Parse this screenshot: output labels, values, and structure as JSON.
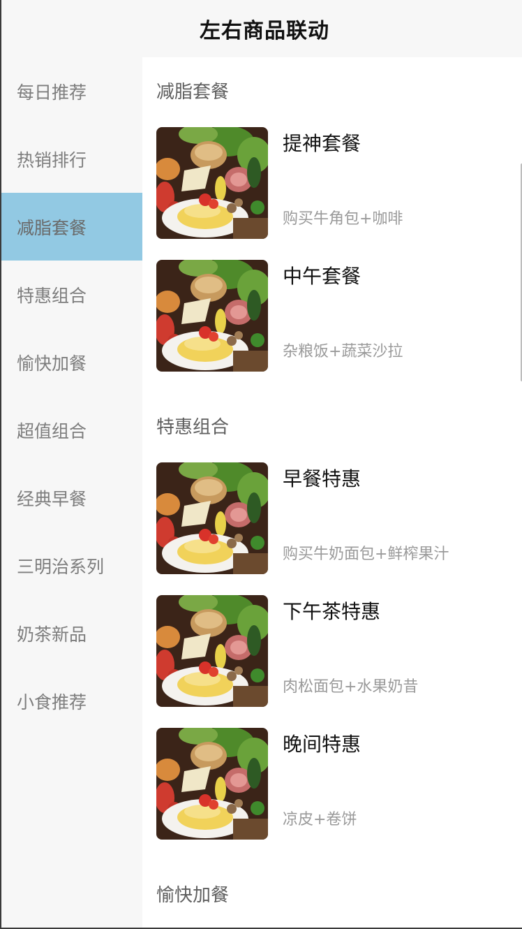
{
  "header": {
    "title": "左右商品联动"
  },
  "sidebar": {
    "active_index": 2,
    "items": [
      {
        "label": "每日推荐"
      },
      {
        "label": "热销排行"
      },
      {
        "label": "减脂套餐"
      },
      {
        "label": "特惠组合"
      },
      {
        "label": "愉快加餐"
      },
      {
        "label": "超值组合"
      },
      {
        "label": "经典早餐"
      },
      {
        "label": "三明治系列"
      },
      {
        "label": "奶茶新品"
      },
      {
        "label": "小食推荐"
      }
    ]
  },
  "content": {
    "sections": [
      {
        "title": "减脂套餐",
        "products": [
          {
            "name": "提神套餐",
            "desc": "购买牛角包+咖啡",
            "image": "food-platter-image"
          },
          {
            "name": "中午套餐",
            "desc": "杂粮饭+蔬菜沙拉",
            "image": "food-platter-image"
          }
        ]
      },
      {
        "title": "特惠组合",
        "products": [
          {
            "name": "早餐特惠",
            "desc": "购买牛奶面包+鲜榨果汁",
            "image": "food-platter-image"
          },
          {
            "name": "下午茶特惠",
            "desc": "肉松面包+水果奶昔",
            "image": "food-platter-image"
          },
          {
            "name": "晚间特惠",
            "desc": "凉皮+卷饼",
            "image": "food-platter-image"
          }
        ]
      },
      {
        "title": "愉快加餐",
        "products": []
      }
    ]
  },
  "colors": {
    "active_sidebar_bg": "#92c9e3",
    "sidebar_bg": "#f7f7f7",
    "sidebar_text": "#7d7d7d",
    "desc_text": "#9a9a9a"
  }
}
